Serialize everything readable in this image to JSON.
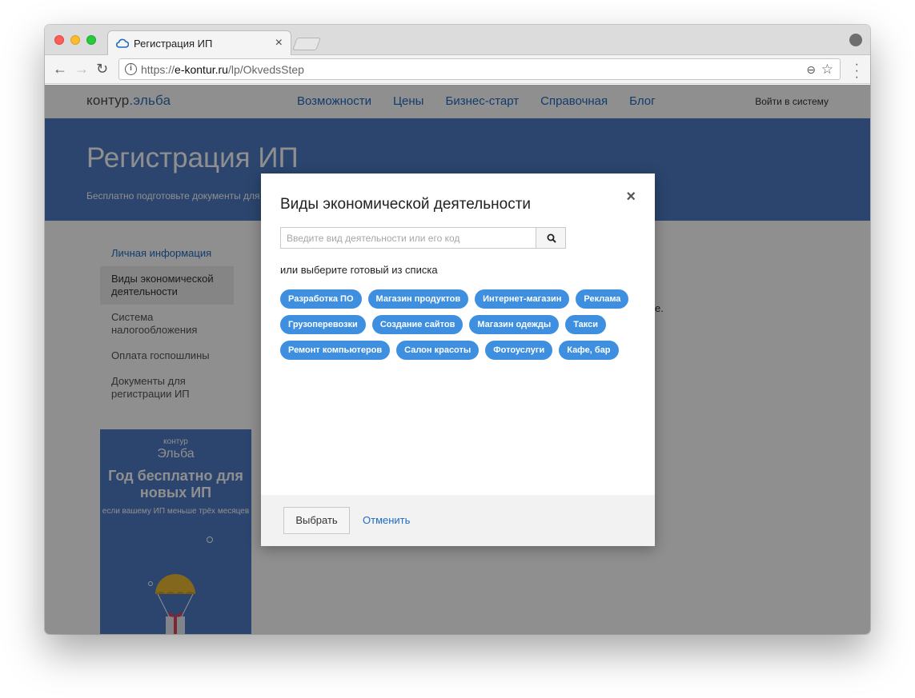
{
  "browser": {
    "tab_title": "Регистрация ИП",
    "tab_close": "×",
    "url_scheme": "https://",
    "url_host": "e-kontur.ru",
    "url_path": "/lp/OkvedsStep"
  },
  "site": {
    "logo_main": "контур",
    "logo_accent": ".эльба",
    "nav": [
      "Возможности",
      "Цены",
      "Бизнес-старт",
      "Справочная",
      "Блог"
    ],
    "login": "Войти в систему"
  },
  "hero": {
    "title": "Регистрация ИП",
    "subtitle": "Бесплатно подготовьте документы для регистрации ИП"
  },
  "sidebar": {
    "items": [
      "Личная информация",
      "Виды экономической деятельности",
      "Система налогообложения",
      "Оплата госпошлины",
      "Документы для регистрации ИП"
    ]
  },
  "promo": {
    "brand_small": "контур",
    "brand": "Эльба",
    "title": "Год бесплатно для новых ИП",
    "subtitle": "если вашему ИП меньше трёх месяцев"
  },
  "behind_text": "е.",
  "modal": {
    "title": "Виды экономической деятельности",
    "close": "×",
    "search_placeholder": "Введите вид деятельности или его код",
    "pick_hint": "или выберите готовый из списка",
    "chips": [
      [
        "Разработка ПО",
        "Магазин продуктов",
        "Интернет-магазин",
        "Реклама"
      ],
      [
        "Грузоперевозки",
        "Создание сайтов",
        "Магазин одежды",
        "Такси"
      ],
      [
        "Ремонт компьютеров",
        "Салон красоты",
        "Фотоуслуги",
        "Кафе, бар"
      ]
    ],
    "choose_button": "Выбрать",
    "cancel_link": "Отменить"
  },
  "colors": {
    "accent": "#3e8fdf",
    "link": "#1f6bc2",
    "hero": "#4d7bc5"
  }
}
